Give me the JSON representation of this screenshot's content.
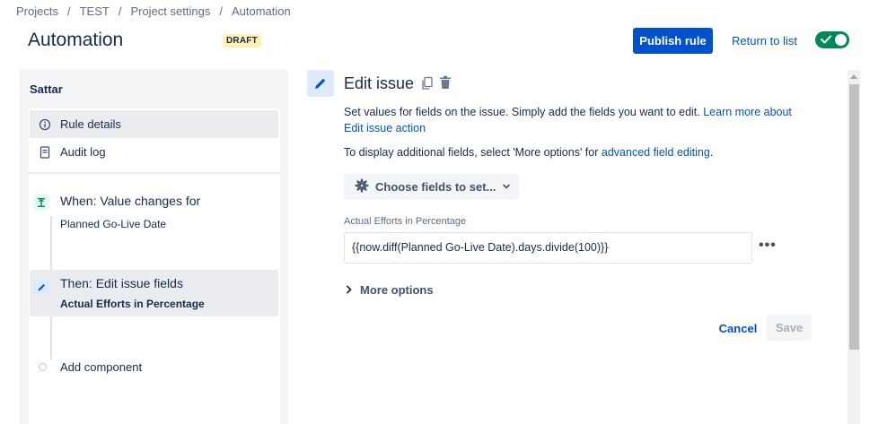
{
  "breadcrumb": [
    "Projects",
    "TEST",
    "Project settings",
    "Automation"
  ],
  "page_title": "Automation",
  "draft_badge": "DRAFT",
  "header": {
    "publish_label": "Publish rule",
    "return_label": "Return to list",
    "toggle_state": "on"
  },
  "sidebar": {
    "rule_name": "Sattar",
    "items": [
      {
        "label": "Rule details",
        "icon": "info-icon"
      },
      {
        "label": "Audit log",
        "icon": "document-icon"
      }
    ],
    "trigger": {
      "title": "When: Value changes for",
      "subtitle": "Planned Go-Live Date",
      "icon": "trigger-icon"
    },
    "action": {
      "title": "Then: Edit issue fields",
      "subtitle": "Actual Efforts in Percentage",
      "icon": "pencil-icon"
    },
    "add_component": "Add component"
  },
  "editor": {
    "title": "Edit issue",
    "desc_text": "Set values for fields on the issue. Simply add the fields you want to edit.",
    "desc_link": "Learn more about Edit issue action",
    "desc2_text": "To display additional fields, select 'More options' for",
    "desc2_link": "advanced field editing",
    "desc2_end": ".",
    "choose_label": "Choose fields to set...",
    "field_label": "Actual Efforts in Percentage",
    "field_value": "{{now.diff(Planned Go-Live Date).days.divide(100)}}",
    "more_options": "More options",
    "cancel_label": "Cancel",
    "save_label": "Save"
  },
  "colors": {
    "primary": "#0052cc",
    "toggle_on": "#00875a",
    "draft_bg": "#fff0b3"
  }
}
